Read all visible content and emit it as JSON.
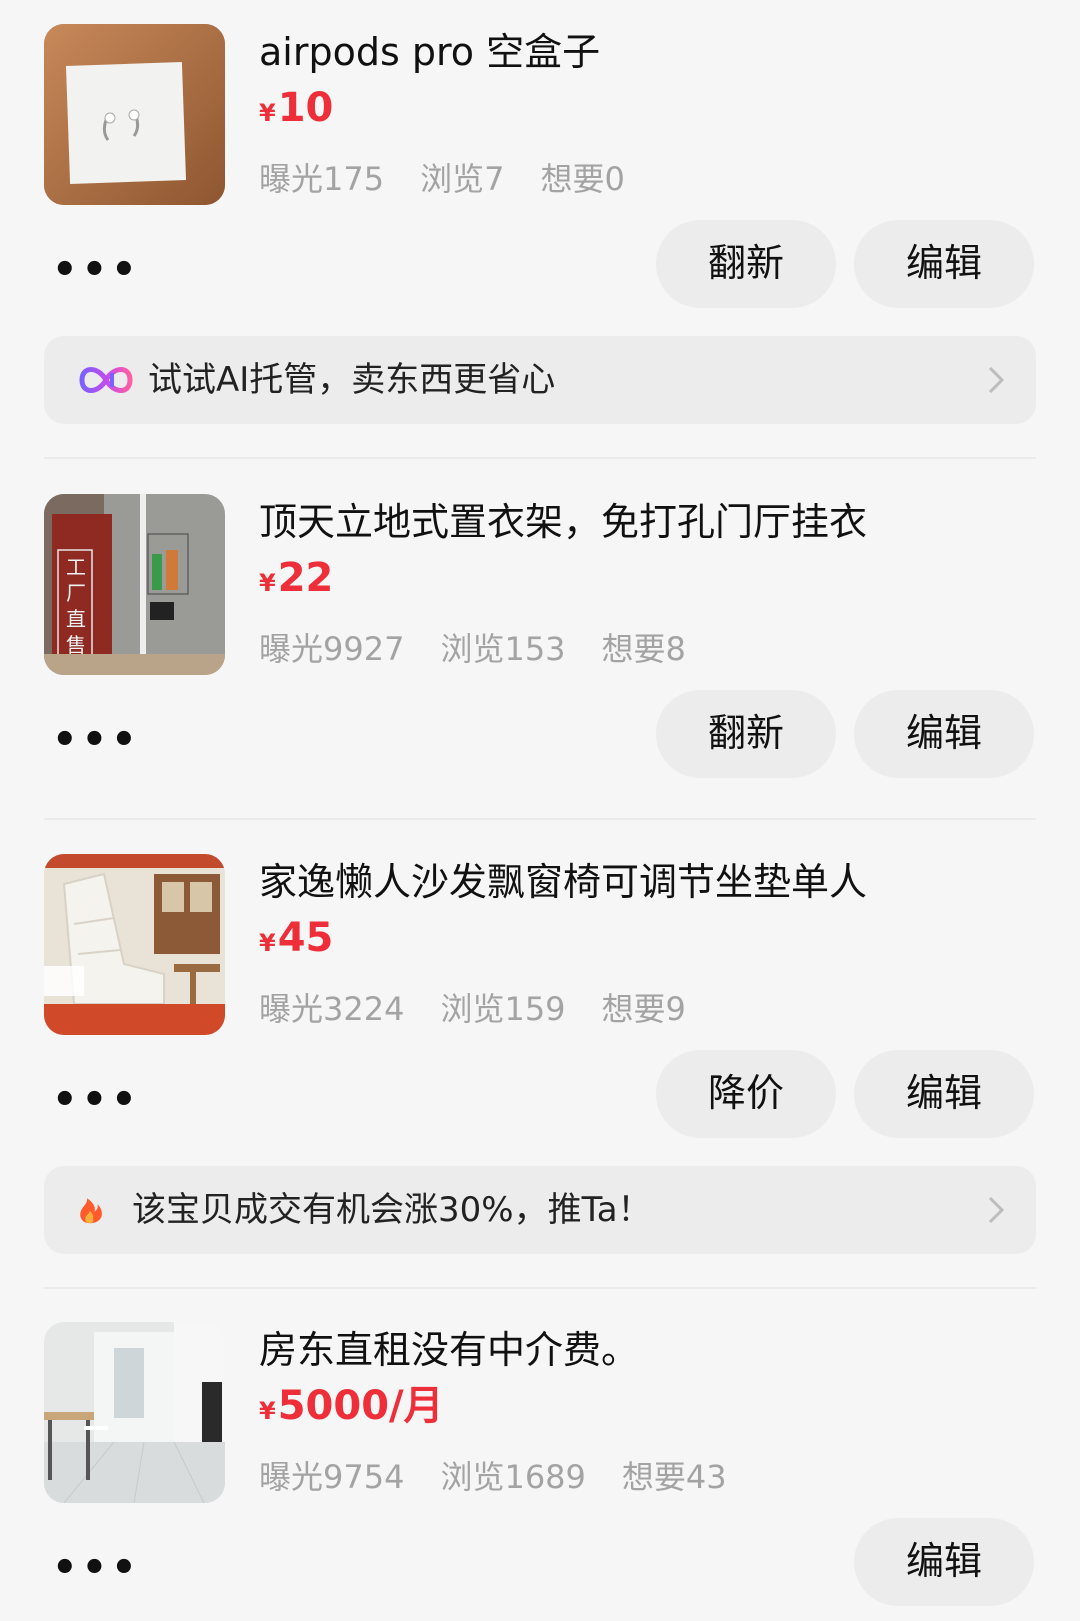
{
  "items": [
    {
      "title": "airpods pro 空盒子",
      "currency": "¥",
      "price": "10",
      "stats": {
        "exposure": "曝光175",
        "views": "浏览7",
        "wants": "想要0"
      },
      "more_label": "•••",
      "buttons": [
        "翻新",
        "编辑"
      ],
      "banner": {
        "text": "试试AI托管，卖东西更省心",
        "icon": "ai-loop-icon"
      }
    },
    {
      "title": "顶天立地式置衣架，免打孔门厅挂衣",
      "currency": "¥",
      "price": "22",
      "stats": {
        "exposure": "曝光9927",
        "views": "浏览153",
        "wants": "想要8"
      },
      "more_label": "•••",
      "buttons": [
        "翻新",
        "编辑"
      ],
      "thumb_text": "工厂直售"
    },
    {
      "title": "家逸懒人沙发飘窗椅可调节坐垫单人",
      "currency": "¥",
      "price": "45",
      "stats": {
        "exposure": "曝光3224",
        "views": "浏览159",
        "wants": "想要9"
      },
      "more_label": "•••",
      "buttons": [
        "降价",
        "编辑"
      ],
      "banner": {
        "text": "该宝贝成交有机会涨30%，推Ta！",
        "icon": "fire-icon"
      }
    },
    {
      "title": "房东直租没有中介费。",
      "currency": "¥",
      "price": "5000/月",
      "stats": {
        "exposure": "曝光9754",
        "views": "浏览1689",
        "wants": "想要43"
      },
      "more_label": "•••",
      "buttons": [
        "编辑"
      ]
    }
  ],
  "colors": {
    "price": "#ee2f3a",
    "button_bg": "#ececec",
    "stats": "#a3a3a3",
    "page_bg": "#f6f6f6"
  }
}
